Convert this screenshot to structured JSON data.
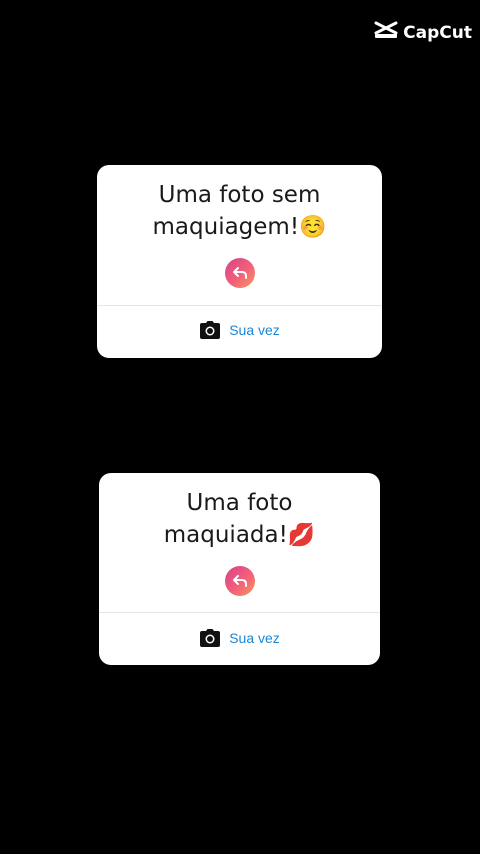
{
  "watermark": {
    "text": "CapCut",
    "icon": "capcut-logo-icon"
  },
  "cards": [
    {
      "line1": "Uma foto sem",
      "line2": "maquiagem!",
      "emoji": "☺️",
      "reply_icon": "reply-arrow-icon",
      "action_icon": "camera-icon",
      "action_label": "Sua vez"
    },
    {
      "line1": "Uma foto",
      "line2": "maquiada!",
      "emoji": "💋",
      "reply_icon": "reply-arrow-icon",
      "action_icon": "camera-icon",
      "action_label": "Sua vez"
    }
  ],
  "colors": {
    "background": "#000000",
    "card": "#ffffff",
    "action_text": "#1b86d6",
    "reply_gradient_start": "#d6428a",
    "reply_gradient_end": "#f69a5b"
  }
}
